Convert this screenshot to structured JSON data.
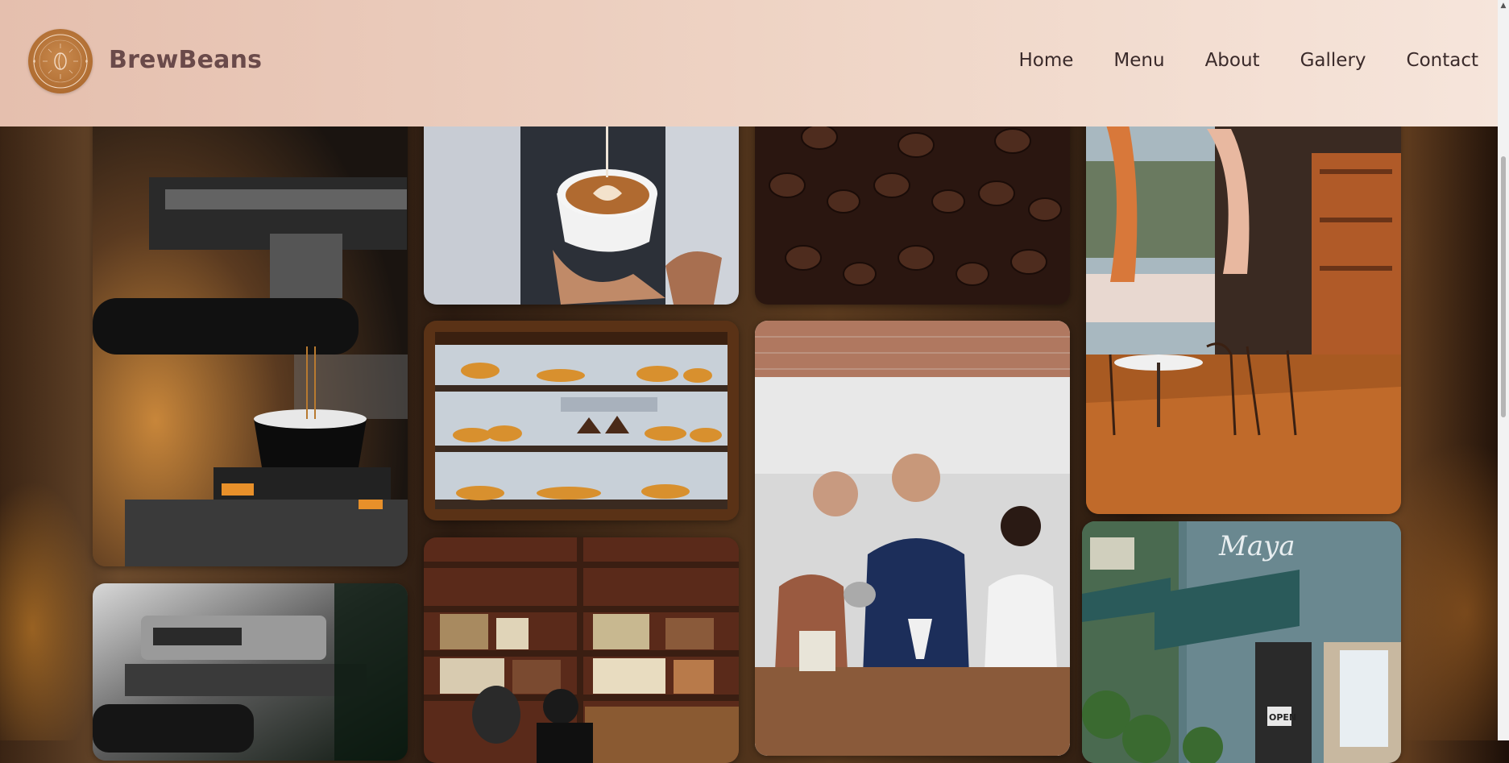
{
  "brand": {
    "name": "BrewBeans",
    "logo_icon": "coffee-badge-icon"
  },
  "nav": [
    {
      "label": "Home"
    },
    {
      "label": "Menu"
    },
    {
      "label": "About"
    },
    {
      "label": "Gallery"
    },
    {
      "label": "Contact"
    }
  ],
  "gallery": {
    "tiles": [
      {
        "subject": "espresso-machine"
      },
      {
        "subject": "latte-art"
      },
      {
        "subject": "coffee-beans"
      },
      {
        "subject": "cafe-interior"
      },
      {
        "subject": "pastry-display"
      },
      {
        "subject": "brewing-lesson"
      },
      {
        "subject": "bookshelf-cafe"
      },
      {
        "subject": "storefront"
      },
      {
        "subject": "espresso-group-head"
      }
    ],
    "storefront_sign": "Maya",
    "storefront_open_sign": "OPEN"
  },
  "colors": {
    "header_start": "#e5bfae",
    "header_end": "#f6e5db",
    "brand_text": "#6a4a4a",
    "nav_text": "#3a2a2a",
    "logo": "#b06d32"
  }
}
